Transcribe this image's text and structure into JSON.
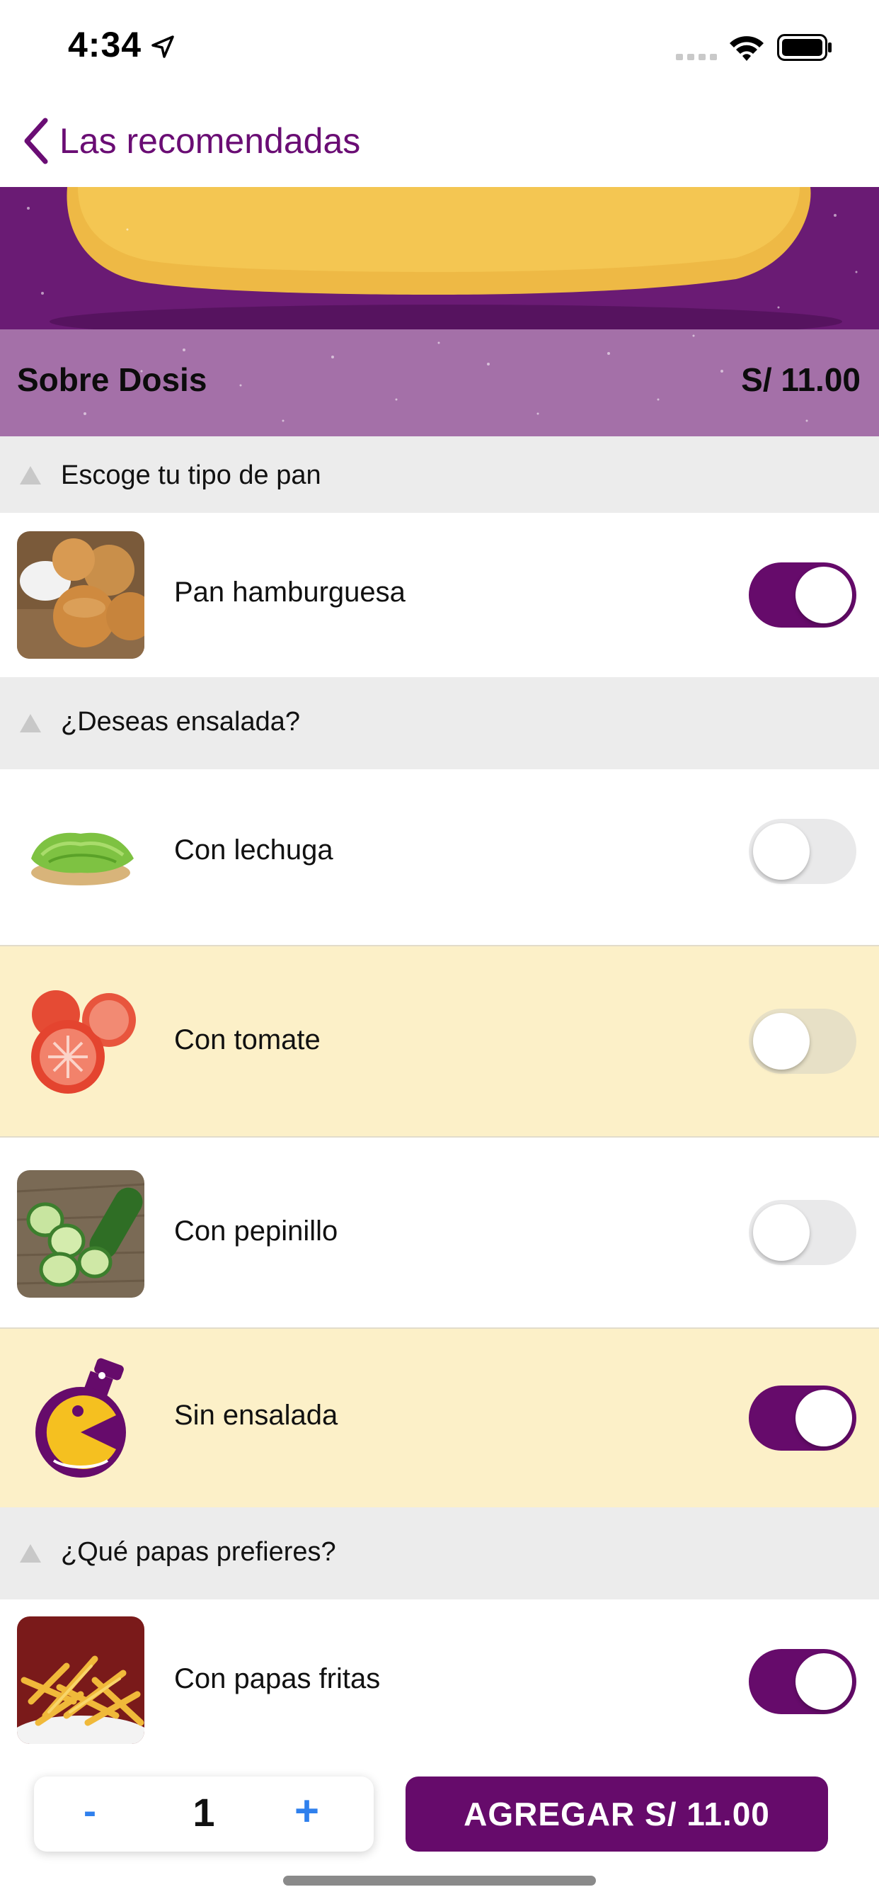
{
  "status_bar": {
    "time": "4:34"
  },
  "nav": {
    "back_label": "Las recomendadas"
  },
  "product": {
    "name": "Sobre Dosis",
    "price": "S/ 11.00"
  },
  "sections": [
    {
      "title": "Escoge tu tipo de pan",
      "options": [
        {
          "label": "Pan hamburguesa",
          "selected": true,
          "icon": "bread-buns-photo"
        }
      ]
    },
    {
      "title": "¿Deseas ensalada?",
      "options": [
        {
          "label": "Con lechuga",
          "selected": false,
          "icon": "lettuce-photo"
        },
        {
          "label": "Con tomate",
          "selected": false,
          "icon": "tomato-photo"
        },
        {
          "label": "Con pepinillo",
          "selected": false,
          "icon": "cucumber-photo"
        },
        {
          "label": "Sin ensalada",
          "selected": true,
          "icon": "brand-flask-logo"
        }
      ]
    },
    {
      "title": "¿Qué papas prefieres?",
      "options": [
        {
          "label": "Con papas fritas",
          "selected": true,
          "icon": "fries-photo"
        }
      ]
    }
  ],
  "cart": {
    "minus": "-",
    "quantity": "1",
    "plus": "+",
    "add_label": "AGREGAR S/ 11.00"
  },
  "colors": {
    "brand": "#660b6b",
    "hero_bar": "#a470a8",
    "highlight_row": "#fcf0c8",
    "section_header": "#ececec",
    "qty_controls": "#2f80ed"
  }
}
